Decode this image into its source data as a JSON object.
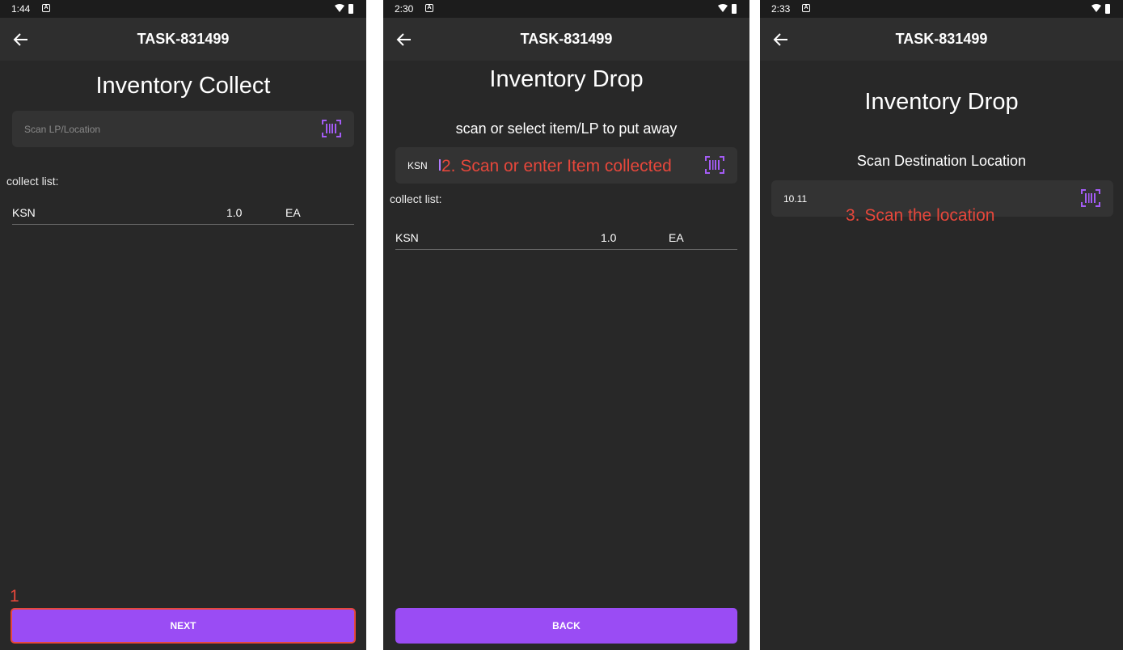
{
  "colors": {
    "background": "#282828",
    "appbar": "#2e2e2e",
    "field": "#333333",
    "accent": "#9a4cf4",
    "annotation": "#e6473b",
    "text": "#ffffff"
  },
  "screens": [
    {
      "status": {
        "time": "1:44"
      },
      "appbar": {
        "title": "TASK-831499",
        "back_icon": "arrow-left-icon"
      },
      "heading": "Inventory Collect",
      "scan_field": {
        "placeholder": "Scan LP/Location",
        "value": "",
        "icon": "barcode-scan-icon"
      },
      "list_label": "collect list:",
      "rows": [
        {
          "item": "KSN",
          "qty": "1.0",
          "unit": "EA"
        }
      ],
      "button": {
        "label": "NEXT"
      },
      "annotation": "1"
    },
    {
      "status": {
        "time": "2:30"
      },
      "appbar": {
        "title": "TASK-831499",
        "back_icon": "arrow-left-icon"
      },
      "heading": "Inventory Drop",
      "subheading": "scan or select item/LP to put away",
      "scan_field": {
        "placeholder": "",
        "value": "KSN",
        "icon": "barcode-scan-icon"
      },
      "list_label": "collect list:",
      "rows": [
        {
          "item": "KSN",
          "qty": "1.0",
          "unit": "EA"
        }
      ],
      "button": {
        "label": "BACK"
      },
      "annotation": "2. Scan or enter Item collected"
    },
    {
      "status": {
        "time": "2:33"
      },
      "appbar": {
        "title": "TASK-831499",
        "back_icon": "arrow-left-icon"
      },
      "heading": "Inventory Drop",
      "subheading": "Scan Destination Location",
      "scan_field": {
        "placeholder": "",
        "value": "10.11",
        "icon": "barcode-scan-icon"
      },
      "annotation": "3. Scan the location"
    }
  ]
}
